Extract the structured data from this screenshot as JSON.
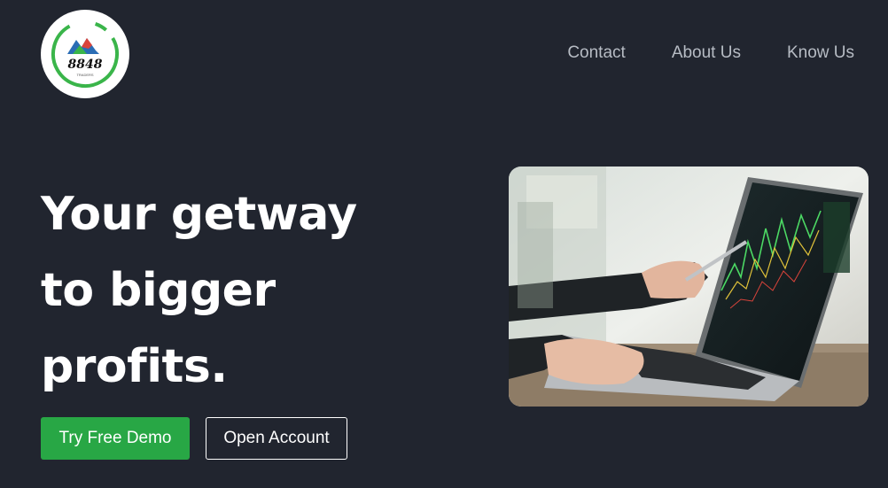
{
  "brand": {
    "logo_text": "8848",
    "logo_subtext": "TRADERS",
    "colors": {
      "ring": "#3ab54a",
      "mountain_blue": "#2a6db5",
      "mountain_red": "#d9443b"
    }
  },
  "nav": {
    "items": [
      {
        "label": "Contact"
      },
      {
        "label": "About Us"
      },
      {
        "label": "Know Us"
      }
    ]
  },
  "hero": {
    "headline_lines": [
      "Your getway",
      "to bigger",
      "profits."
    ],
    "primary_button": "Try Free Demo",
    "secondary_button": "Open Account",
    "image_alt": "laptop-trading-chart"
  },
  "colors": {
    "background": "#21252f",
    "accent_green": "#28a745",
    "nav_text": "#b7bcc4"
  }
}
